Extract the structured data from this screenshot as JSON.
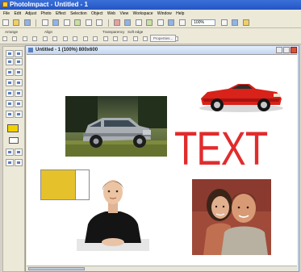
{
  "app": {
    "title": "PhotoImpact - Untitled - 1"
  },
  "menu": {
    "items": [
      "File",
      "Edit",
      "Adjust",
      "Photo",
      "Effect",
      "Selection",
      "Object",
      "Web",
      "View",
      "Workspace",
      "Window",
      "Help"
    ]
  },
  "toolbar": {
    "zoom_value": "100%"
  },
  "options_bar": {
    "labels": [
      "Arrange",
      "Align",
      "Transparency",
      "Soft edge"
    ],
    "properties_label": "Properties..."
  },
  "document": {
    "title": "Untitled - 1 (100%) 800x600"
  },
  "canvas": {
    "text_object": "TEXT",
    "colors": {
      "text": "#e12c2c",
      "rect_fill": "#e5c22b",
      "car": "#d8221a",
      "suv": "#9aa0a6"
    }
  },
  "icons": {
    "toolbar": [
      "new-icon",
      "open-icon",
      "save-icon",
      "print-icon",
      "cut-icon",
      "copy-icon",
      "paste-icon",
      "undo-icon",
      "redo-icon"
    ],
    "tools": [
      "pick-tool-icon",
      "selection-tool-icon",
      "crop-tool-icon",
      "transform-tool-icon",
      "text-tool-icon",
      "brush-tool-icon",
      "eraser-tool-icon",
      "clone-tool-icon",
      "fill-tool-icon",
      "zoom-tool-icon"
    ]
  }
}
